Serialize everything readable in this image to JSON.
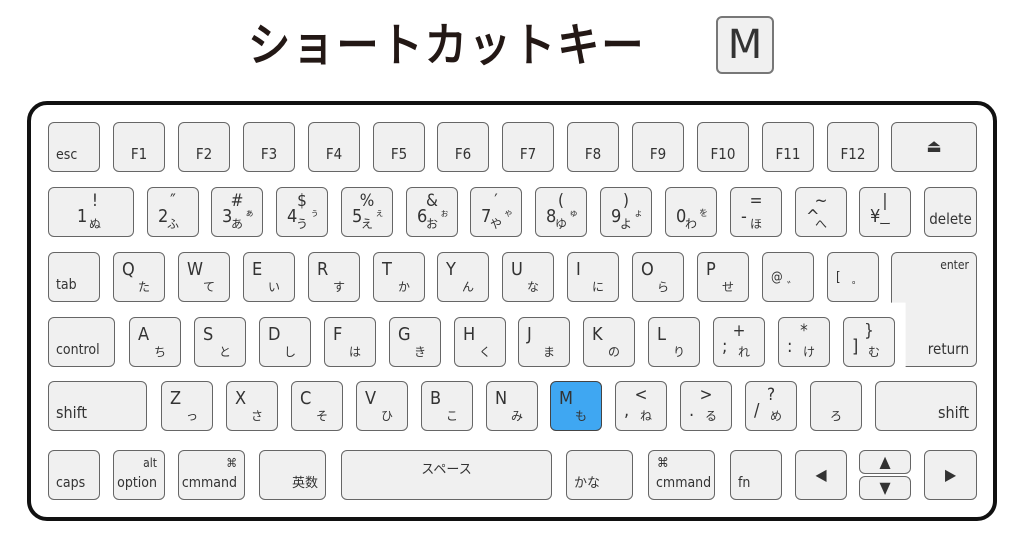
{
  "header": {
    "title": "ショートカットキー",
    "shortcut_key": "M"
  },
  "colors": {
    "highlight": "#3fa7f2",
    "key_fill": "#f0f0f0",
    "border": "#111111"
  },
  "keyboard": {
    "row1": [
      "esc",
      "F1",
      "F2",
      "F3",
      "F4",
      "F5",
      "F6",
      "F7",
      "F8",
      "F9",
      "F10",
      "F11",
      "F12"
    ],
    "eject_icon": "⏏",
    "row2": [
      {
        "main": "1",
        "top": "!",
        "kana": "ぬ",
        "kana2": ""
      },
      {
        "main": "2",
        "top": "″",
        "kana": "ふ",
        "kana2": ""
      },
      {
        "main": "3",
        "top": "#",
        "kana": "あ",
        "kana2": "ぁ"
      },
      {
        "main": "4",
        "top": "$",
        "kana": "う",
        "kana2": "ぅ"
      },
      {
        "main": "5",
        "top": "%",
        "kana": "え",
        "kana2": "ぇ"
      },
      {
        "main": "6",
        "top": "&",
        "kana": "お",
        "kana2": "ぉ"
      },
      {
        "main": "7",
        "top": "′",
        "kana": "や",
        "kana2": "ゃ"
      },
      {
        "main": "8",
        "top": "(",
        "kana": "ゆ",
        "kana2": "ゅ"
      },
      {
        "main": "9",
        "top": ")",
        "kana": "よ",
        "kana2": "ょ"
      },
      {
        "main": "0",
        "top": "",
        "kana": "わ",
        "kana2": "を"
      },
      {
        "main": "-",
        "top": "=",
        "kana": "ほ",
        "kana2": ""
      },
      {
        "main": "^",
        "top": "~",
        "kana": "へ",
        "kana2": ""
      },
      {
        "main": "¥",
        "top": "|",
        "kana": "ー",
        "kana2": ""
      }
    ],
    "delete": "delete",
    "tab": "tab",
    "row3": [
      {
        "main": "Q",
        "kana": "た"
      },
      {
        "main": "W",
        "kana": "て"
      },
      {
        "main": "E",
        "kana": "い"
      },
      {
        "main": "R",
        "kana": "す"
      },
      {
        "main": "T",
        "kana": "か"
      },
      {
        "main": "Y",
        "kana": "ん"
      },
      {
        "main": "U",
        "kana": "な"
      },
      {
        "main": "I",
        "kana": "に"
      },
      {
        "main": "O",
        "kana": "ら"
      },
      {
        "main": "P",
        "kana": "せ"
      },
      {
        "main": "@",
        "kana": "゛"
      },
      {
        "main": "[",
        "kana": "゜"
      }
    ],
    "enter_top": "enter",
    "return": "return",
    "control": "control",
    "row4": [
      {
        "main": "A",
        "kana": "ち"
      },
      {
        "main": "S",
        "kana": "と"
      },
      {
        "main": "D",
        "kana": "し"
      },
      {
        "main": "F",
        "kana": "は"
      },
      {
        "main": "G",
        "kana": "き"
      },
      {
        "main": "H",
        "kana": "く"
      },
      {
        "main": "J",
        "kana": "ま"
      },
      {
        "main": "K",
        "kana": "の"
      },
      {
        "main": "L",
        "kana": "り"
      },
      {
        "main": ";",
        "kana": "れ",
        "top": "+"
      },
      {
        "main": ":",
        "kana": "け",
        "top": "*"
      },
      {
        "main": "]",
        "kana": "む",
        "top": "}"
      }
    ],
    "shift_left": "shift",
    "row5": [
      {
        "main": "Z",
        "kana": "っ"
      },
      {
        "main": "X",
        "kana": "さ"
      },
      {
        "main": "C",
        "kana": "そ"
      },
      {
        "main": "V",
        "kana": "ひ"
      },
      {
        "main": "B",
        "kana": "こ"
      },
      {
        "main": "N",
        "kana": "み"
      },
      {
        "main": "M",
        "kana": "も"
      },
      {
        "main": ",",
        "kana": "ね",
        "top": "<"
      },
      {
        "main": ".",
        "kana": "る",
        "top": ">"
      },
      {
        "main": "/",
        "kana": "め",
        "top": "?"
      },
      {
        "main": "",
        "kana": "ろ",
        "top": ""
      }
    ],
    "shift_right": "shift",
    "caps": "caps",
    "option_top": "alt",
    "option": "option",
    "command_symbol": "⌘",
    "command": "cmmand",
    "eisu": "英数",
    "space": "スペース",
    "kana_key": "かな",
    "fn": "fn",
    "arrow_left": "◀",
    "arrow_up": "▲",
    "arrow_down": "▼",
    "arrow_right": "▶"
  }
}
